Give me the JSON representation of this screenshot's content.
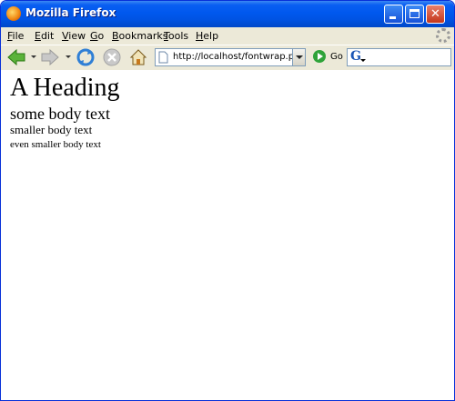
{
  "window": {
    "title": "Mozilla Firefox",
    "controls": {
      "minimize": "minimize",
      "maximize": "maximize",
      "close": "close"
    }
  },
  "menubar": {
    "items": [
      "File",
      "Edit",
      "View",
      "Go",
      "Bookmarks",
      "Tools",
      "Help"
    ]
  },
  "toolbar": {
    "address_url": "http://localhost/fontwrap.php",
    "go_label": "Go",
    "search_value": ""
  },
  "page": {
    "heading": "A Heading",
    "body_text": "some body text",
    "smaller_text": "smaller body text",
    "even_smaller_text": "even smaller body text"
  },
  "colors": {
    "titlebar_blue": "#0058ee",
    "close_red": "#c4371c",
    "chrome_bg": "#ece9d8"
  },
  "icons": [
    "firefox-icon",
    "back-arrow-icon",
    "forward-arrow-icon",
    "reload-icon",
    "stop-icon",
    "home-icon",
    "page-icon",
    "go-icon",
    "google-icon",
    "throbber-icon"
  ]
}
